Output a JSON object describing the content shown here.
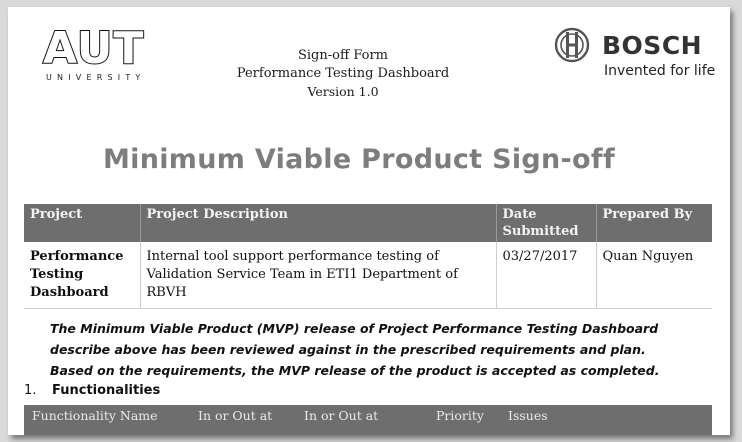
{
  "header": {
    "aut_word": "AUT",
    "aut_sub": "UNIVERSITY",
    "form_title": "Sign-off Form",
    "form_subtitle": "Performance Testing Dashboard",
    "version": "Version 1.0",
    "bosch_word": "BOSCH",
    "bosch_tagline": "Invented for life"
  },
  "title": "Minimum Viable Product Sign-off",
  "signoff_table": {
    "headers": [
      "Project",
      "Project Description",
      "Date Submitted",
      "Prepared By"
    ],
    "row": {
      "project": "Performance Testing Dashboard",
      "description": "Internal tool support performance testing of Validation Service Team in ETI1 Department of RBVH",
      "date": "03/27/2017",
      "prepared_by": "Quan Nguyen"
    }
  },
  "statement": "The Minimum Viable Product (MVP) release of Project Performance Testing Dashboard describe above has been reviewed against in the prescribed requirements and plan. Based on the requirements, the MVP release of the product is accepted as completed.",
  "section": {
    "number": "1.",
    "title": "Functionalities"
  },
  "functionality_table": {
    "headers": [
      "Functionality Name",
      "In or Out at",
      "In or Out at",
      "Priority",
      "Issues"
    ]
  }
}
